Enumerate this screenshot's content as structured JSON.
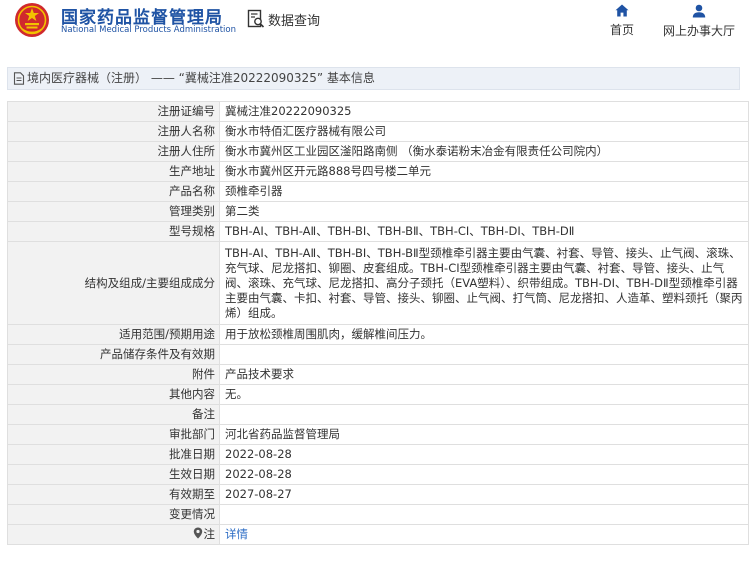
{
  "header": {
    "brand_cn": "国家药品监督管理局",
    "brand_en": "National Medical Products Administration",
    "query_title": "数据查询",
    "nav": [
      {
        "label": "首页",
        "icon": "home-icon"
      },
      {
        "label": "网上办事大厅",
        "icon": "user-icon"
      }
    ]
  },
  "section": {
    "title": "境内医疗器械（注册） —— “冀械注准20222090325” 基本信息"
  },
  "rows": [
    {
      "label": "注册证编号",
      "value": "冀械注准20222090325"
    },
    {
      "label": "注册人名称",
      "value": "衡水市特佰汇医疗器械有限公司"
    },
    {
      "label": "注册人住所",
      "value": "衡水市冀州区工业园区滏阳路南侧 （衡水泰诺粉末冶金有限责任公司院内）"
    },
    {
      "label": "生产地址",
      "value": "衡水市冀州区开元路888号四号楼二单元"
    },
    {
      "label": "产品名称",
      "value": "颈椎牵引器"
    },
    {
      "label": "管理类别",
      "value": "第二类"
    },
    {
      "label": "型号规格",
      "value": "TBH-AⅠ、TBH-AⅡ、TBH-BⅠ、TBH-BⅡ、TBH-CⅠ、TBH-DⅠ、TBH-DⅡ"
    },
    {
      "label": "结构及组成/主要组成成分",
      "value": "TBH-AⅠ、TBH-AⅡ、TBH-BⅠ、TBH-BⅡ型颈椎牵引器主要由气囊、衬套、导管、接头、止气阀、滚珠、充气球、尼龙搭扣、铆圈、皮套组成。TBH-CⅠ型颈椎牵引器主要由气囊、衬套、导管、接头、止气阀、滚珠、充气球、尼龙搭扣、高分子颈托（EVA塑料）、织带组成。TBH-DⅠ、TBH-DⅡ型颈椎牵引器主要由气囊、卡扣、衬套、导管、接头、铆圈、止气阀、打气筒、尼龙搭扣、人造革、塑料颈托（聚丙烯）组成。"
    },
    {
      "label": "适用范围/预期用途",
      "value": "用于放松颈椎周围肌肉，缓解椎间压力。"
    },
    {
      "label": "产品储存条件及有效期",
      "value": ""
    },
    {
      "label": "附件",
      "value": "产品技术要求"
    },
    {
      "label": "其他内容",
      "value": "无。"
    },
    {
      "label": "备注",
      "value": ""
    },
    {
      "label": "审批部门",
      "value": "河北省药品监督管理局"
    },
    {
      "label": "批准日期",
      "value": "2022-08-28"
    },
    {
      "label": "生效日期",
      "value": "2022-08-28"
    },
    {
      "label": "有效期至",
      "value": "2027-08-27"
    },
    {
      "label": "变更情况",
      "value": ""
    },
    {
      "label": "注",
      "value": "详情"
    }
  ],
  "colors": {
    "brand_blue": "#1f53a4",
    "logo_red": "#d0292d",
    "logo_gold": "#f2c200",
    "link_blue": "#2a6bc4",
    "label_bg": "#f2f2f2",
    "section_bg": "#edf1f7"
  }
}
